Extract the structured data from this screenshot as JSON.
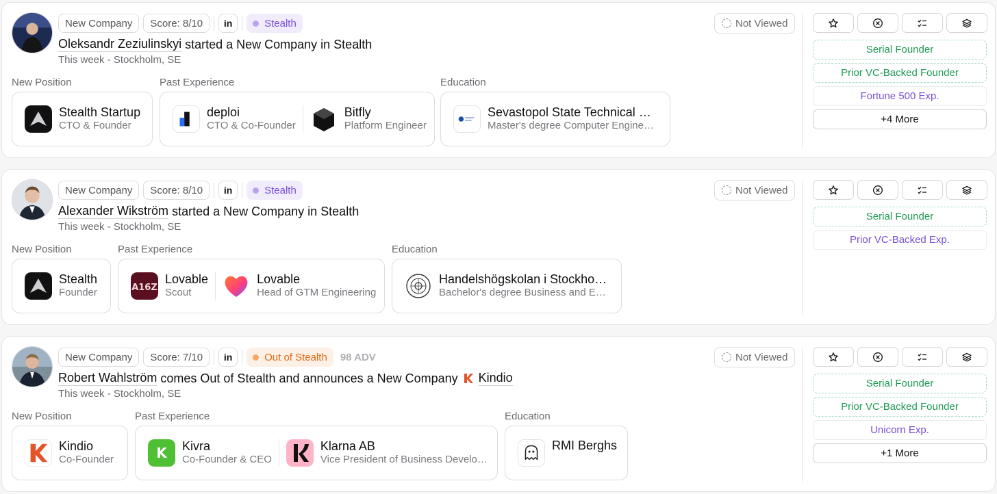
{
  "colors": {
    "stealth": "#7b4fd6",
    "out_of_stealth": "#e46a14",
    "green_tag": "#1f9a55",
    "purple_tag": "#7b4fd6"
  },
  "cards": [
    {
      "type_pill": "New Company",
      "score": "Score: 8/10",
      "linkedin": "in",
      "status": "Stealth",
      "adv": "",
      "name": "Oleksandr Zeziulinskyi",
      "headline_rest": "started a New Company in Stealth",
      "company_name": "",
      "subline": "This week - Stockholm, SE",
      "viewed": "Not Viewed",
      "labels": {
        "new_position": "New Position",
        "past": "Past Experience",
        "education": "Education"
      },
      "new_position": {
        "title": "Stealth Startup",
        "role": "CTO & Founder",
        "logo": "stealth-logo-icon"
      },
      "past": [
        {
          "title": "deploi",
          "role": "CTO & Co-Founder",
          "logo": "deploi-logo-icon"
        },
        {
          "title": "Bitfly",
          "role": "Platform Engineer",
          "logo": "bitfly-logo-icon"
        }
      ],
      "education": {
        "title": "Sevastopol State Technical U...",
        "role": "Master's degree Computer Enginee...",
        "logo": "university-logo-icon"
      },
      "tags": [
        "Serial Founder",
        "Prior VC-Backed Founder",
        "Fortune 500 Exp."
      ],
      "more": "+4 More"
    },
    {
      "type_pill": "New Company",
      "score": "Score: 8/10",
      "linkedin": "in",
      "status": "Stealth",
      "adv": "",
      "name": "Alexander Wikström",
      "headline_rest": "started a New Company in Stealth",
      "company_name": "",
      "subline": "This week - Stockholm, SE",
      "viewed": "Not Viewed",
      "labels": {
        "new_position": "New Position",
        "past": "Past Experience",
        "education": "Education"
      },
      "new_position": {
        "title": "Stealth",
        "role": "Founder",
        "logo": "stealth-logo-icon"
      },
      "past": [
        {
          "title": "Lovable",
          "role": "Scout",
          "logo": "a16z-logo-icon"
        },
        {
          "title": "Lovable",
          "role": "Head of GTM Engineering",
          "logo": "lovable-heart-logo-icon"
        }
      ],
      "education": {
        "title": "Handelshögskolan i Stockholm",
        "role": "Bachelor's degree Business and Ec...",
        "logo": "school-seal-logo-icon"
      },
      "tags": [
        "Serial Founder",
        "Prior VC-Backed Exp."
      ],
      "more": ""
    },
    {
      "type_pill": "New Company",
      "score": "Score: 7/10",
      "linkedin": "in",
      "status": "Out of Stealth",
      "adv": "98 ADV",
      "name": "Robert Wahlström",
      "headline_rest": "comes Out of Stealth and announces a New Company",
      "company_name": "Kindio",
      "subline": "This week - Stockholm, SE",
      "viewed": "Not Viewed",
      "labels": {
        "new_position": "New Position",
        "past": "Past Experience",
        "education": "Education"
      },
      "new_position": {
        "title": "Kindio",
        "role": "Co-Founder",
        "logo": "kindio-logo-icon"
      },
      "past": [
        {
          "title": "Kivra",
          "role": "Co-Founder & CEO",
          "logo": "kivra-logo-icon"
        },
        {
          "title": "Klarna AB",
          "role": "Vice President of Business Develop...",
          "logo": "klarna-logo-icon"
        }
      ],
      "education": {
        "title": "RMI Berghs",
        "role": "",
        "logo": "berghs-ghost-logo-icon"
      },
      "tags": [
        "Serial Founder",
        "Prior VC-Backed Founder",
        "Unicorn Exp."
      ],
      "more": "+1 More"
    }
  ]
}
